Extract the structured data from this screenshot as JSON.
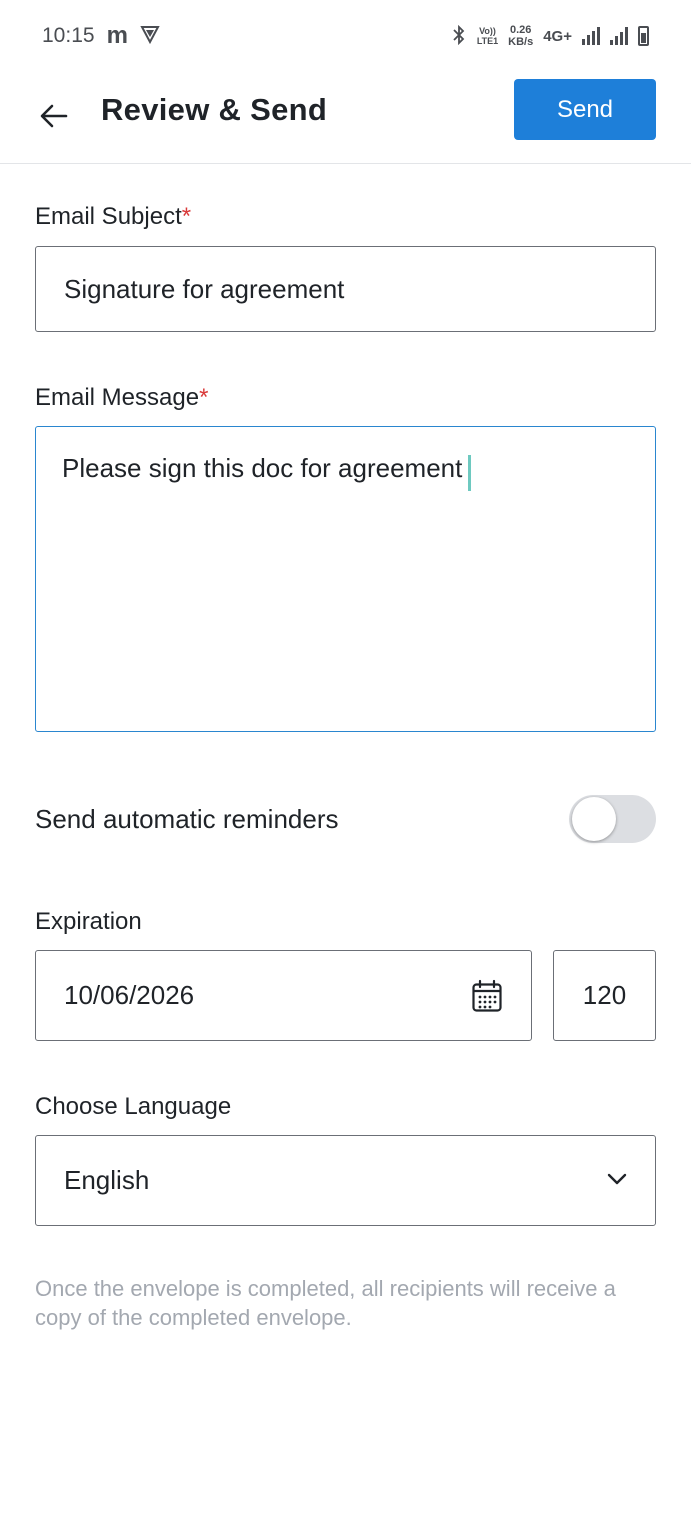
{
  "status_bar": {
    "time": "10:15",
    "app_glyph": "m",
    "volte_top": "Vo))",
    "volte_bottom": "LTE1",
    "speed_value": "0.26",
    "speed_unit": "KB/s",
    "network": "4G+"
  },
  "header": {
    "title": "Review & Send",
    "send_label": "Send",
    "back_icon": "arrow-left-icon"
  },
  "form": {
    "subject_label": "Email Subject",
    "subject_value": "Signature for agreement",
    "message_label": "Email Message",
    "message_value": "Please sign this doc for agreement",
    "required_mark": "*",
    "reminders_label": "Send automatic reminders",
    "reminders_enabled": false,
    "expiration_label": "Expiration",
    "expiration_date": "10/06/2026",
    "expiration_days": "120",
    "language_label": "Choose Language",
    "language_value": "English",
    "footnote": "Once the envelope is completed, all recipients will receive a copy of the completed envelope."
  },
  "colors": {
    "accent": "#1e7fd9",
    "required": "#d93a3a",
    "focus_border": "#2a86cf",
    "muted_text": "#a3a8b0"
  }
}
